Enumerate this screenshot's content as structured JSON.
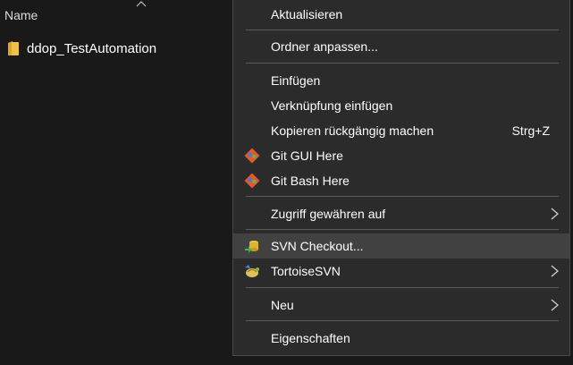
{
  "explorer": {
    "column_header": "Name",
    "files": [
      {
        "name": "ddop_TestAutomation",
        "icon": "folder-icon"
      }
    ]
  },
  "context_menu": {
    "items": [
      {
        "label": "Aktualisieren"
      },
      {
        "label": "Ordner anpassen..."
      },
      {
        "label": "Einfügen"
      },
      {
        "label": "Verknüpfung einfügen"
      },
      {
        "label": "Kopieren rückgängig machen",
        "shortcut": "Strg+Z"
      },
      {
        "label": "Git GUI Here",
        "icon": "git-gui-icon"
      },
      {
        "label": "Git Bash Here",
        "icon": "git-bash-icon"
      },
      {
        "label": "Zugriff gewähren auf",
        "submenu": true
      },
      {
        "label": "SVN Checkout...",
        "icon": "svn-checkout-icon",
        "highlighted": true
      },
      {
        "label": "TortoiseSVN",
        "icon": "tortoisesvn-icon",
        "submenu": true
      },
      {
        "label": "Neu",
        "submenu": true
      },
      {
        "label": "Eigenschaften"
      }
    ]
  },
  "colors": {
    "background": "#191919",
    "menu_background": "#2b2b2b",
    "menu_highlight": "#414141",
    "separator": "#5a5a5a",
    "folder": "#f0c048"
  }
}
